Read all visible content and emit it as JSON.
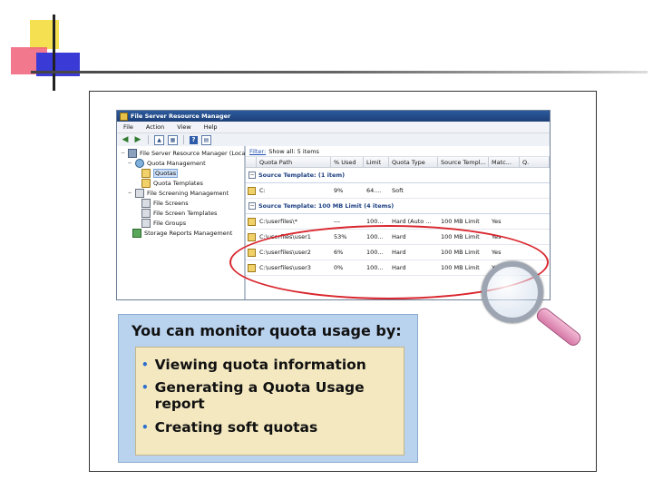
{
  "window": {
    "title": "File Server Resource Manager",
    "menus": [
      "File",
      "Action",
      "View",
      "Help"
    ]
  },
  "tree": {
    "items": [
      {
        "label": "File Server Resource Manager (Local)",
        "depth": 0,
        "icon": "server-icon"
      },
      {
        "label": "Quota Management",
        "depth": 1,
        "icon": "quota-management-icon"
      },
      {
        "label": "Quotas",
        "depth": 2,
        "icon": "quota-icon",
        "selected": true
      },
      {
        "label": "Quota Templates",
        "depth": 2,
        "icon": "quota-template-icon"
      },
      {
        "label": "File Screening Management",
        "depth": 1,
        "icon": "file-screening-icon"
      },
      {
        "label": "File Screens",
        "depth": 2,
        "icon": "file-screen-icon"
      },
      {
        "label": "File Screen Templates",
        "depth": 2,
        "icon": "file-screen-template-icon"
      },
      {
        "label": "File Groups",
        "depth": 2,
        "icon": "file-group-icon"
      },
      {
        "label": "Storage Reports Management",
        "depth": 1,
        "icon": "storage-report-icon"
      }
    ]
  },
  "filter": {
    "label": "Filter:",
    "text": "Show all: 5 items"
  },
  "columns": [
    "Quota Path",
    "% Used",
    "Limit",
    "Quota Type",
    "Source Templ...",
    "Matc...",
    "Q."
  ],
  "groups": [
    {
      "header": "Source Template: (1 item)",
      "rows": [
        {
          "path": "C:",
          "used": "9%",
          "limit": "64....",
          "type": "Soft",
          "template": "",
          "match": ""
        }
      ]
    },
    {
      "header": "Source Template: 100 MB Limit (4 items)",
      "rows": [
        {
          "path": "C:\\userfiles\\*",
          "used": "---",
          "limit": "100...",
          "type": "Hard (Auto ...",
          "template": "100 MB Limit",
          "match": "Yes"
        },
        {
          "path": "C:\\userfiles\\user1",
          "used": "53%",
          "limit": "100...",
          "type": "Hard",
          "template": "100 MB Limit",
          "match": "Yes"
        },
        {
          "path": "C:\\userfiles\\user2",
          "used": "6%",
          "limit": "100...",
          "type": "Hard",
          "template": "100 MB Limit",
          "match": "Yes"
        },
        {
          "path": "C:\\userfiles\\user3",
          "used": "0%",
          "limit": "100...",
          "type": "Hard",
          "template": "100 MB Limit",
          "match": "Yes"
        }
      ]
    }
  ],
  "callout": {
    "title": "You can monitor quota usage by:",
    "bullets": [
      "Viewing quota information",
      "Generating a Quota Usage report",
      "Creating soft quotas"
    ]
  },
  "colors": {
    "highlight": "#d9262e",
    "callout_bg": "#b9d2ee",
    "callout_inner_bg": "#f3e8c0"
  }
}
